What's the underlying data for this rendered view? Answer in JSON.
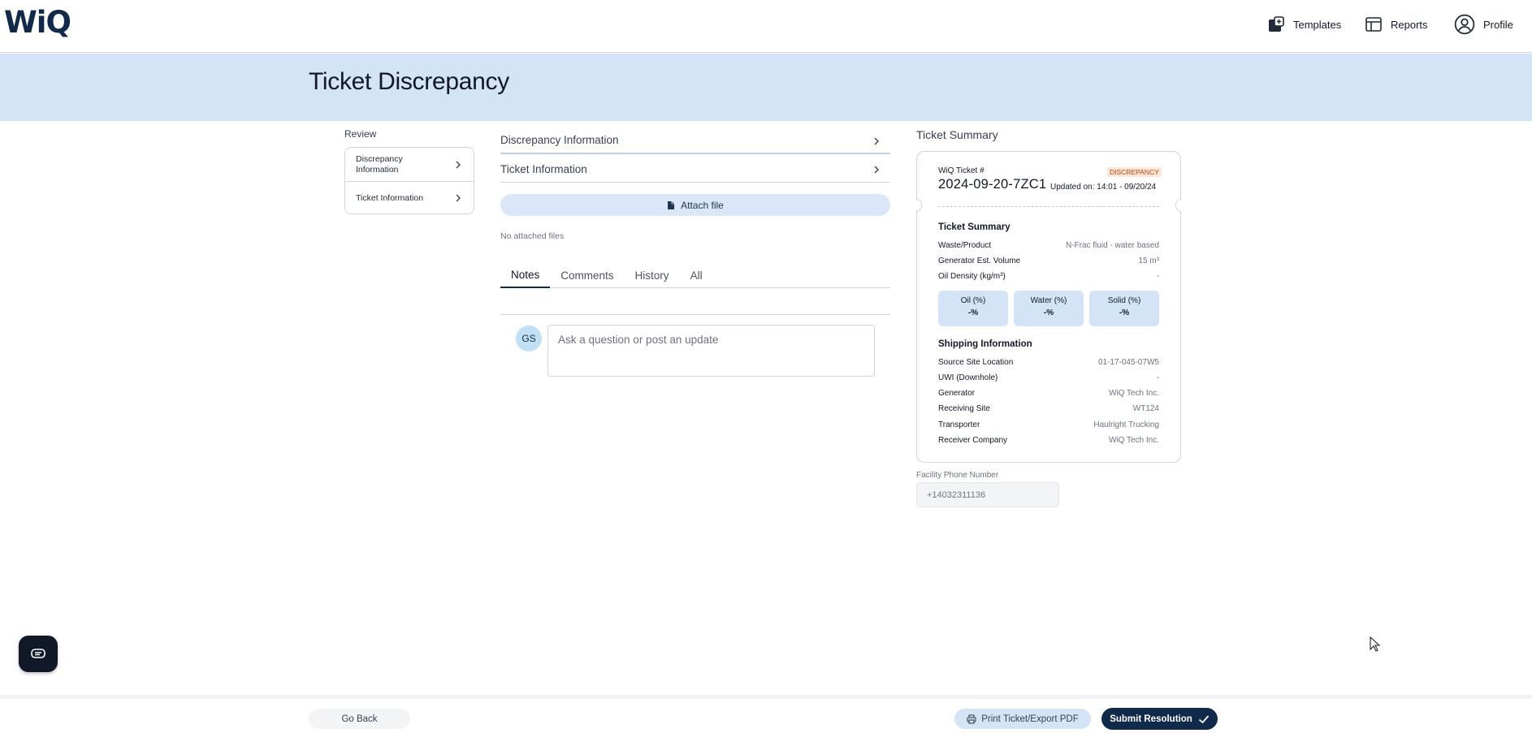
{
  "app": {
    "logo": "WiQ"
  },
  "nav": {
    "templates": "Templates",
    "reports": "Reports",
    "profile": "Profile"
  },
  "page": {
    "title": "Ticket Discrepancy"
  },
  "review": {
    "label": "Review",
    "items": [
      {
        "label": "Discrepancy Information"
      },
      {
        "label": "Ticket Information"
      }
    ]
  },
  "main": {
    "sections": [
      {
        "label": "Discrepancy Information"
      },
      {
        "label": "Ticket Information"
      }
    ],
    "attach_label": "Attach file",
    "no_files": "No attached files",
    "tabs": [
      {
        "label": "Notes",
        "active": true
      },
      {
        "label": "Comments"
      },
      {
        "label": "History"
      },
      {
        "label": "All"
      }
    ],
    "avatar_initials": "GS",
    "note_placeholder": "Ask a question or post an update"
  },
  "summary": {
    "heading": "Ticket Summary",
    "ticket_label": "WiQ Ticket #",
    "badge": "DISCREPANCY",
    "ticket_number": "2024-09-20-7ZC1",
    "updated": "Updated on: 14:01 - 09/20/24",
    "ticket_section": "Ticket Summary",
    "rows": [
      {
        "key": "Waste/Product",
        "value": "N-Frac fluid - water based"
      },
      {
        "key": "Generator Est. Volume",
        "value": "15 m³"
      },
      {
        "key": "Oil Density (kg/m³)",
        "value": "-"
      }
    ],
    "composition": [
      {
        "label": "Oil (%)",
        "value": "-%"
      },
      {
        "label": "Water (%)",
        "value": "-%"
      },
      {
        "label": "Solid (%)",
        "value": "-%"
      }
    ],
    "shipping_section": "Shipping Information",
    "shipping_rows": [
      {
        "key": "Source Site Location",
        "value": "01-17-045-07W5"
      },
      {
        "key": "UWI (Downhole)",
        "value": "-"
      },
      {
        "key": "Generator",
        "value": "WiQ Tech Inc."
      },
      {
        "key": "Receiving Site",
        "value": "WT124"
      },
      {
        "key": "Transporter",
        "value": "Haulright Trucking"
      },
      {
        "key": "Receiver Company",
        "value": "WiQ Tech Inc."
      }
    ]
  },
  "facility": {
    "label": "Facility Phone Number",
    "placeholder": "+14032311136"
  },
  "footer": {
    "go_back": "Go Back",
    "print": "Print Ticket/Export PDF",
    "submit": "Submit Resolution"
  },
  "colors": {
    "brand_navy": "#0f2a4a",
    "light_blue": "#d4e4f7",
    "badge_orange": "#c2410c"
  },
  "icons": [
    "templates-icon",
    "reports-icon",
    "profile-icon",
    "chevron-right-icon",
    "file-icon",
    "chat-icon",
    "printer-icon",
    "check-icon",
    "cursor-icon"
  ]
}
